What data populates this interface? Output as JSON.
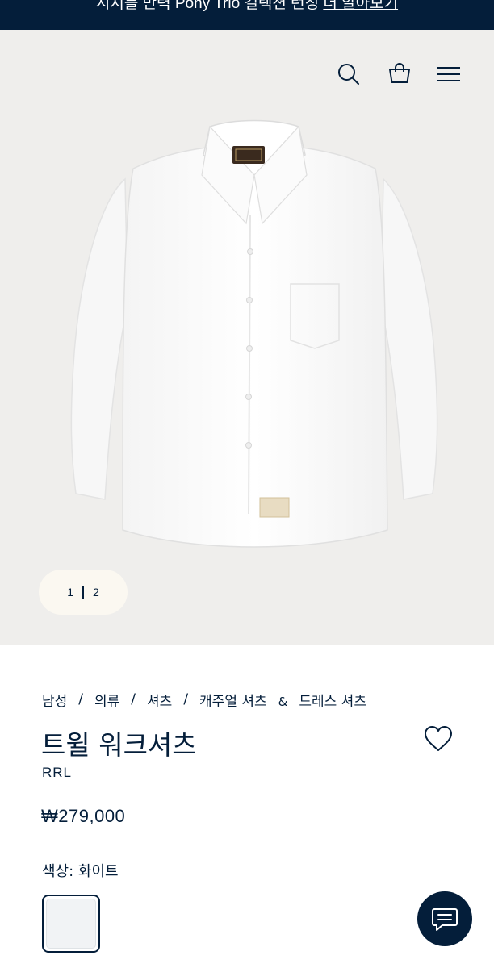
{
  "banner": {
    "text": "시지를 만력 Pony Trio 컬렉션 런칭 ",
    "link_text": "더 알아보기"
  },
  "header": {
    "icons": [
      "search-icon",
      "shopping-bag-icon",
      "hamburger-menu-icon"
    ]
  },
  "gallery": {
    "current": "1",
    "total": "2"
  },
  "breadcrumb": {
    "items": [
      "남성",
      "의류",
      "셔츠",
      "캐주얼 셔츠"
    ],
    "amp": "&",
    "last": "드레스 셔츠",
    "separator": "/"
  },
  "product": {
    "title": "트윌 워크셔츠",
    "brand": "RRL",
    "price": "₩279,000",
    "color_label": "색상:",
    "color_value": "화이트"
  },
  "colors": {
    "navy": "#041e3a",
    "hero_background": "#efeeec",
    "pager_background": "#fbf8f1"
  }
}
